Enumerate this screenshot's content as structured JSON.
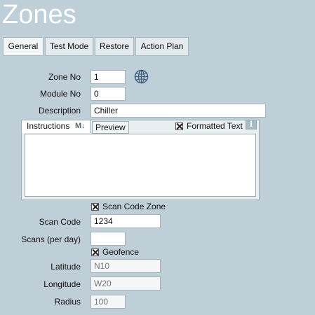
{
  "page": {
    "title": "Zones"
  },
  "tabs": [
    {
      "label": "General"
    },
    {
      "label": "Test Mode"
    },
    {
      "label": "Restore"
    },
    {
      "label": "Action Plan"
    }
  ],
  "form": {
    "zone_no": {
      "label": "Zone No",
      "value": "1"
    },
    "module_no": {
      "label": "Module No",
      "value": "0"
    },
    "description": {
      "label": "Description",
      "value": "Chiller"
    },
    "instructions": {
      "tab_label": "Instructions",
      "markdown_badge": "M↓",
      "preview_label": "Preview",
      "formatted_text_label": "Formatted Text",
      "formatted_text_checked": true,
      "value": ""
    },
    "scan_code_zone": {
      "label": "Scan Code Zone",
      "checked": true
    },
    "scan_code": {
      "label": "Scan Code",
      "value": "1234"
    },
    "scans_per_day": {
      "label": "Scans (per day)",
      "value": ""
    },
    "geofence": {
      "label": "Geofence",
      "checked": true
    },
    "latitude": {
      "label": "Latitude",
      "value": "N10"
    },
    "longitude": {
      "label": "Longitude",
      "value": "W20"
    },
    "radius": {
      "label": "Radius",
      "value": "100"
    }
  },
  "colors": {
    "background": "#bfcfd8",
    "globe_icon": "#3d5b7a"
  },
  "icons": {
    "globe": "globe-icon",
    "info": "info-icon"
  }
}
